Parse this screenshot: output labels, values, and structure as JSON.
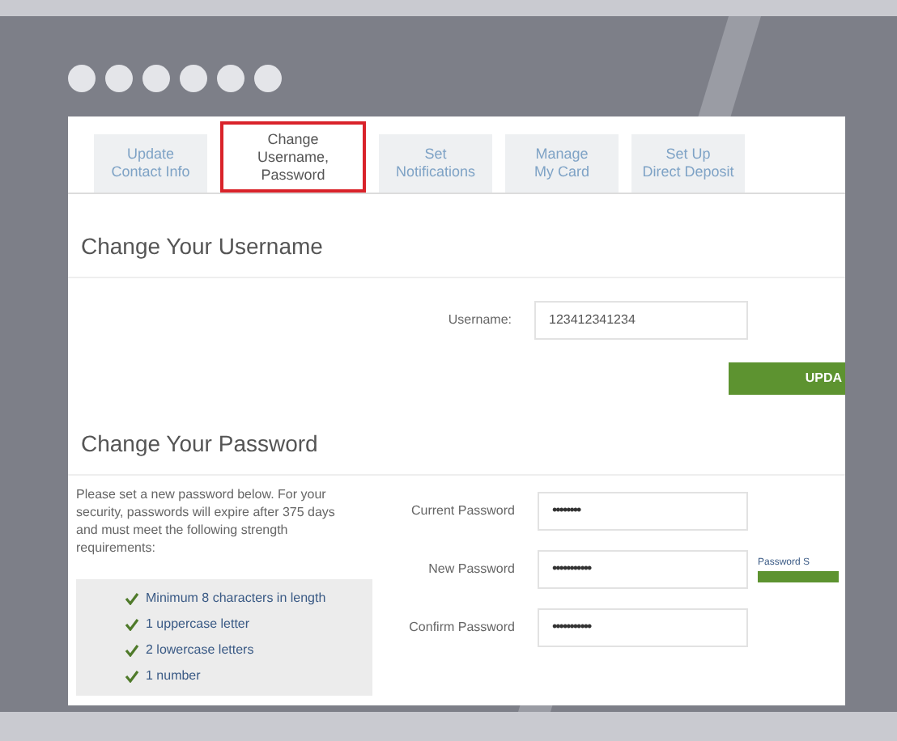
{
  "tabs": [
    {
      "label": "Update\nContact Info",
      "selected": false
    },
    {
      "label": "Change\nUsername,\nPassword",
      "selected": true
    },
    {
      "label": "Set\nNotifications",
      "selected": false
    },
    {
      "label": "Manage\nMy Card",
      "selected": false
    },
    {
      "label": "Set Up\nDirect Deposit",
      "selected": false
    }
  ],
  "username_section": {
    "heading": "Change Your Username",
    "label": "Username:",
    "value": "123412341234",
    "button": "UPDA"
  },
  "password_section": {
    "heading": "Change Your Password",
    "intro": "Please set a new password below. For your security, passwords will expire after 375 days and must meet the following strength requirements:",
    "requirements": [
      {
        "text": "Minimum 8 characters in length",
        "met": true
      },
      {
        "text": "1 uppercase letter",
        "met": true
      },
      {
        "text": "2 lowercase letters",
        "met": true
      },
      {
        "text": "1 number",
        "met": true
      }
    ],
    "fields": [
      {
        "label": "Current Password",
        "value": "••••••••"
      },
      {
        "label": "New Password",
        "value": "•••••••••••"
      },
      {
        "label": "Confirm Password",
        "value": "•••••••••••"
      }
    ],
    "strength": {
      "label": "Password S",
      "level": 1
    }
  }
}
